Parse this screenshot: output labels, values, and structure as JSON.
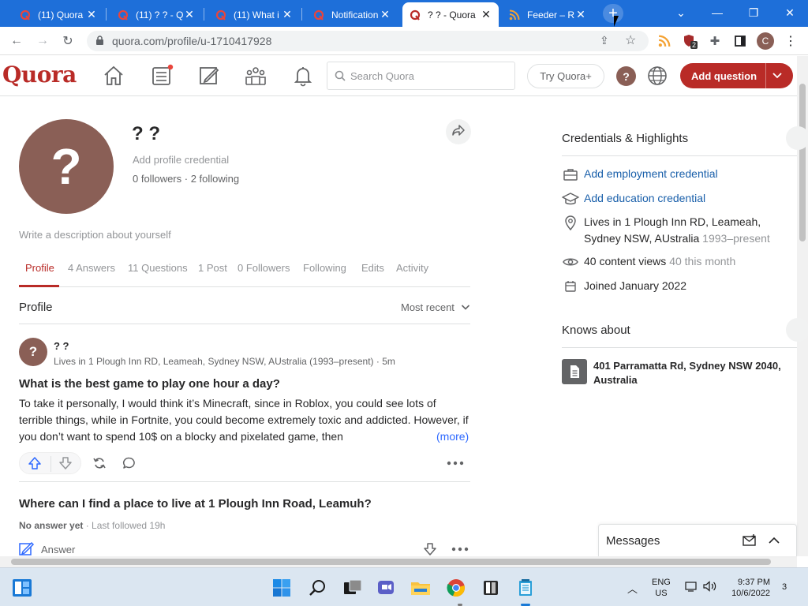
{
  "browser": {
    "tabs": [
      {
        "title": "(11) Quora",
        "favicon": "quora-icon",
        "active": false
      },
      {
        "title": "(11) ? ? - Q",
        "favicon": "quora-icon",
        "active": false
      },
      {
        "title": "(11) What i",
        "favicon": "quora-icon",
        "active": false
      },
      {
        "title": "Notification",
        "favicon": "quora-icon",
        "active": false
      },
      {
        "title": "? ? - Quora",
        "favicon": "quora-icon",
        "active": true
      },
      {
        "title": "Feeder – RS",
        "favicon": "rss-icon",
        "active": false
      }
    ],
    "new_tab": "+",
    "url": "quora.com/profile/u-1710417928",
    "extension_badge": "2",
    "profile_initial": "C",
    "accent_color": "#1e6fd9"
  },
  "quora": {
    "logo": "Quora",
    "search_placeholder": "Search Quora",
    "try_plus": "Try Quora+",
    "avatar_initial": "?",
    "add_question": "Add question",
    "brand_color": "#b92b27"
  },
  "profile": {
    "avatar_glyph": "?",
    "name": "? ?",
    "credential_prompt": "Add profile credential",
    "followers": "0 followers · 2 following",
    "description_prompt": "Write a description about yourself",
    "tabs": [
      "Profile",
      "4 Answers",
      "11 Questions",
      "1 Post",
      "0 Followers",
      "Following",
      "Edits",
      "Activity"
    ],
    "active_tab": "Profile",
    "section_title": "Profile",
    "sort_label": "Most recent"
  },
  "feed": {
    "post": {
      "avatar_glyph": "?",
      "author": "? ?",
      "meta": "Lives in 1 Plough Inn RD, Leameah, Sydney NSW, AUstralia (1993–present) · 5m",
      "question": "What is the best game to play one hour a day?",
      "body": "To take it personally, I would think it’s Minecraft, since in Roblox, you could see lots of terrible things, while in Fortnite, you could become extremely toxic and addicted. However, if you don’t want to spend 10$ on a blocky and pixelated game, then",
      "more": "(more)"
    },
    "question2": {
      "title": "Where can I find a place to live at 1 Plough Inn Road, Leamuh?",
      "no_answer": "No answer yet",
      "followed": " · Last followed 19h",
      "answer_label": "Answer"
    }
  },
  "sidebar": {
    "credentials_title": "Credentials & Highlights",
    "employment": "Add employment credential",
    "education": "Add education credential",
    "location": "Lives in 1 Plough Inn RD, Leameah, Sydney NSW, AUstralia",
    "location_years": "1993–present",
    "views": "40 content views",
    "views_month": "40 this month",
    "joined": "Joined January 2022",
    "knows_title": "Knows about",
    "knows_topic": "401 Parramatta Rd, Sydney NSW 2040, Australia",
    "messages": "Messages"
  },
  "taskbar": {
    "lang_line1": "ENG",
    "lang_line2": "US",
    "time": "9:37 PM",
    "date": "10/6/2022",
    "notifications": "3"
  }
}
